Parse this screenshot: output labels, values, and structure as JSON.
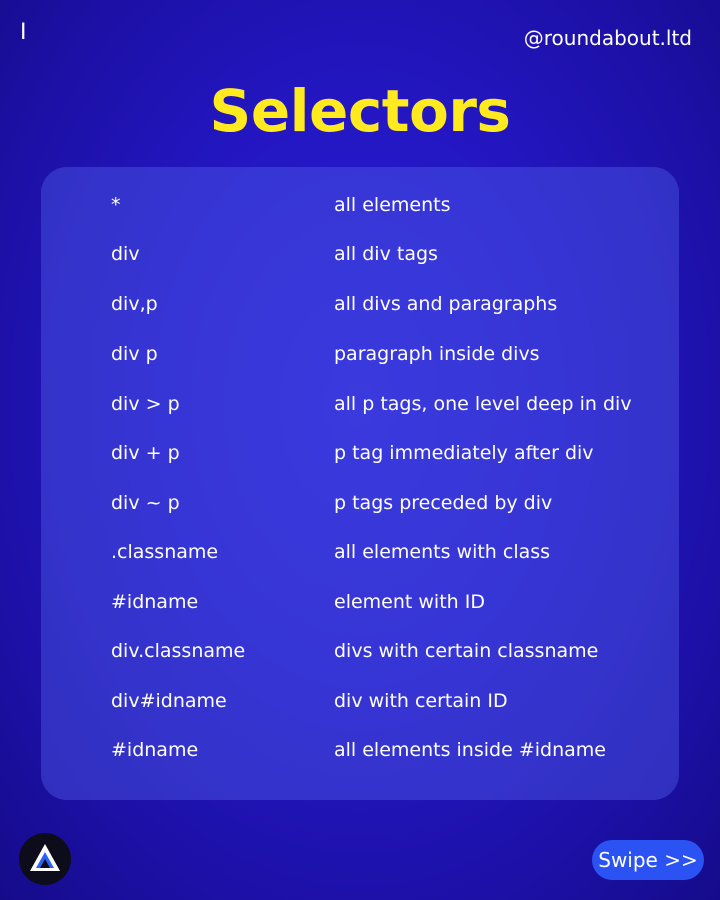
{
  "header": {
    "page_number": "I",
    "handle": "@roundabout.ltd"
  },
  "title": "Selectors",
  "rows": [
    {
      "selector": "*",
      "description": "all elements"
    },
    {
      "selector": "div",
      "description": "all div tags"
    },
    {
      "selector": "div,p",
      "description": "all divs and paragraphs"
    },
    {
      "selector": "div p",
      "description": "paragraph inside divs"
    },
    {
      "selector": "div > p",
      "description": "all p tags, one level deep in div"
    },
    {
      "selector": "div + p",
      "description": "p tag immediately after div"
    },
    {
      "selector": "div ~ p",
      "description": "p tags preceded by div"
    },
    {
      "selector": ".classname",
      "description": "all elements with class"
    },
    {
      "selector": "#idname",
      "description": "element with ID"
    },
    {
      "selector": "div.classname",
      "description": "divs with certain classname"
    },
    {
      "selector": "div#idname",
      "description": "div with certain ID"
    },
    {
      "selector": "#idname",
      "description": "all elements inside #idname"
    }
  ],
  "footer": {
    "logo_icon": "roundabout-logo-icon",
    "swipe_label": "Swipe >>"
  },
  "colors": {
    "background": "#2417c4",
    "title": "#ffea1f",
    "panel": "#5060eb",
    "swipe_button": "#2b52f2"
  }
}
